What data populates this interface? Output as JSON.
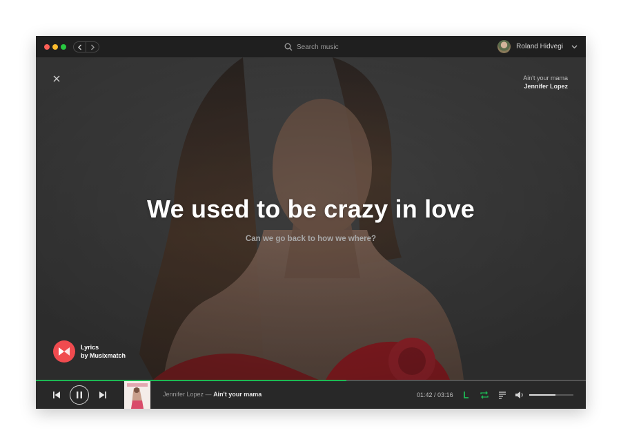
{
  "titlebar": {
    "search": {
      "placeholder": "Search music"
    },
    "user": {
      "name": "Roland Hidvegi"
    }
  },
  "now_playing": {
    "song": "Ain't your mama",
    "artist": "Jennifer Lopez"
  },
  "lyrics": {
    "current": "We used to be crazy in love",
    "next": "Can we go back to how we where?"
  },
  "credit": {
    "line1": "Lyrics",
    "line2": "by Musixmatch"
  },
  "player": {
    "artist": "Jennifer Lopez",
    "separator": " — ",
    "song": "Ain't your mama",
    "elapsed": "01:42",
    "time_sep": " / ",
    "duration": "03:16",
    "progress_fraction": 0.565,
    "volume_fraction": 0.6
  },
  "colors": {
    "accent": "#1db954",
    "musixmatch": "#f04b4f",
    "window_bg": "#282828"
  },
  "icons": [
    "close-icon",
    "search-icon",
    "chevron-left-icon",
    "chevron-right-icon",
    "chevron-down-icon",
    "previous-icon",
    "pause-icon",
    "next-icon",
    "lyrics-icon",
    "repeat-icon",
    "queue-icon",
    "volume-icon",
    "musixmatch-logo-icon"
  ]
}
